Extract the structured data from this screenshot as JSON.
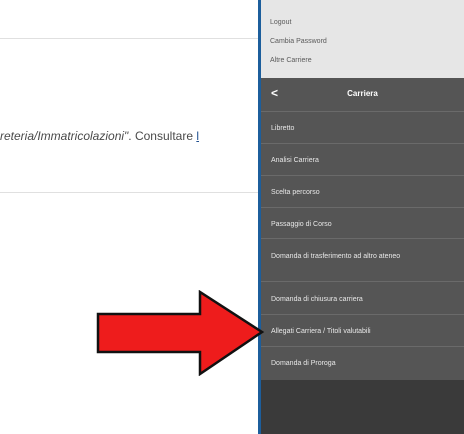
{
  "content": {
    "text_italic": "reteria/Immatricolazioni\"",
    "text_rest": ". Consultare ",
    "text_link": "l"
  },
  "user_menu": {
    "items": [
      "Logout",
      "Cambia Password",
      "Altre Carriere"
    ]
  },
  "career_menu": {
    "back_symbol": "<",
    "title": "Carriera",
    "items": [
      "Libretto",
      "Analisi Carriera",
      "Scelta percorso",
      "Passaggio di Corso",
      "Domanda di trasferimento ad altro ateneo",
      "Domanda di chiusura carriera",
      "Allegati Carriera / Titoli valutabili",
      "Domanda di Proroga"
    ]
  },
  "colors": {
    "arrow_fill": "#ee1c1c",
    "arrow_stroke": "#111111",
    "panel_bg": "#555555",
    "accent_edge": "#1c5e9c"
  },
  "icons": {
    "arrow": "red-arrow-pointer-icon"
  }
}
